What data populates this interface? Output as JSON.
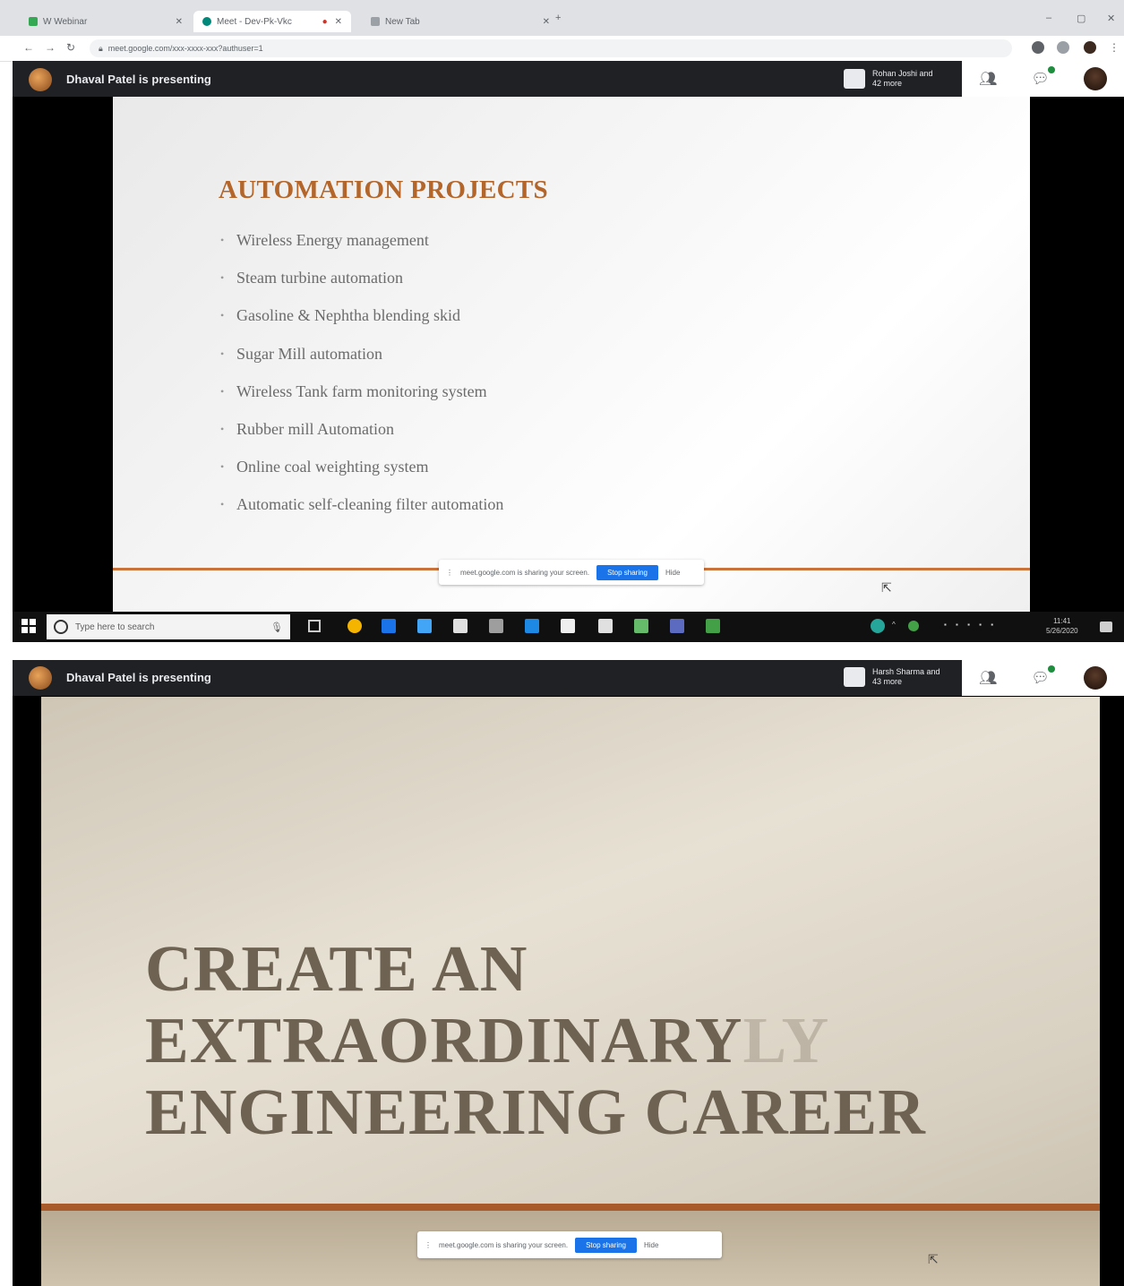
{
  "browser": {
    "tabs": [
      {
        "label": "W Webinar",
        "active": false,
        "favicon_color": "#34a853"
      },
      {
        "label": "Meet - Dev-Pk-Vkc",
        "active": true,
        "favicon_color": "#00897b"
      },
      {
        "label": "New Tab",
        "active": false,
        "favicon_color": "#9aa0a6"
      }
    ],
    "url": "meet.google.com/xxx-xxxx-xxx?authuser=1"
  },
  "meet_top": {
    "presenter_text": "Dhaval Patel is presenting",
    "participants_text": "Rohan Joshi and 42 more"
  },
  "slide1": {
    "title": "AUTOMATION PROJECTS",
    "bullets": [
      "Wireless Energy management",
      "Steam turbine automation",
      "Gasoline & Nephtha blending skid",
      "Sugar Mill automation",
      "Wireless Tank farm monitoring system",
      "Rubber mill Automation",
      "Online coal weighting system",
      "Automatic self-cleaning filter automation"
    ],
    "sharebar_text": "meet.google.com is sharing your screen.",
    "stop_label": "Stop sharing",
    "hide_label": "Hide"
  },
  "taskbar": {
    "search_placeholder": "Type here to search",
    "clock_time": "11:41",
    "clock_date": "5/26/2020",
    "app_colors": [
      "#f4b400",
      "#1a73e8",
      "#42a5f5",
      "#e0e0e0",
      "#9e9e9e",
      "#1e88e5",
      "#eeeeee",
      "#e0e0e0",
      "#66bb6a",
      "#5c6bc0",
      "#43a047"
    ]
  },
  "meet_bottom": {
    "presenter_text": "Dhaval Patel is presenting",
    "participants_text": "Harsh Sharma and 43 more"
  },
  "slide2": {
    "line1": "CREATE AN",
    "line2": "EXTRAORDINARY",
    "line2_ghost": "LY",
    "line3": "ENGINEERING CAREER",
    "sharebar_text": "meet.google.com is sharing your screen.",
    "stop_label": "Stop sharing",
    "hide_label": "Hide"
  }
}
